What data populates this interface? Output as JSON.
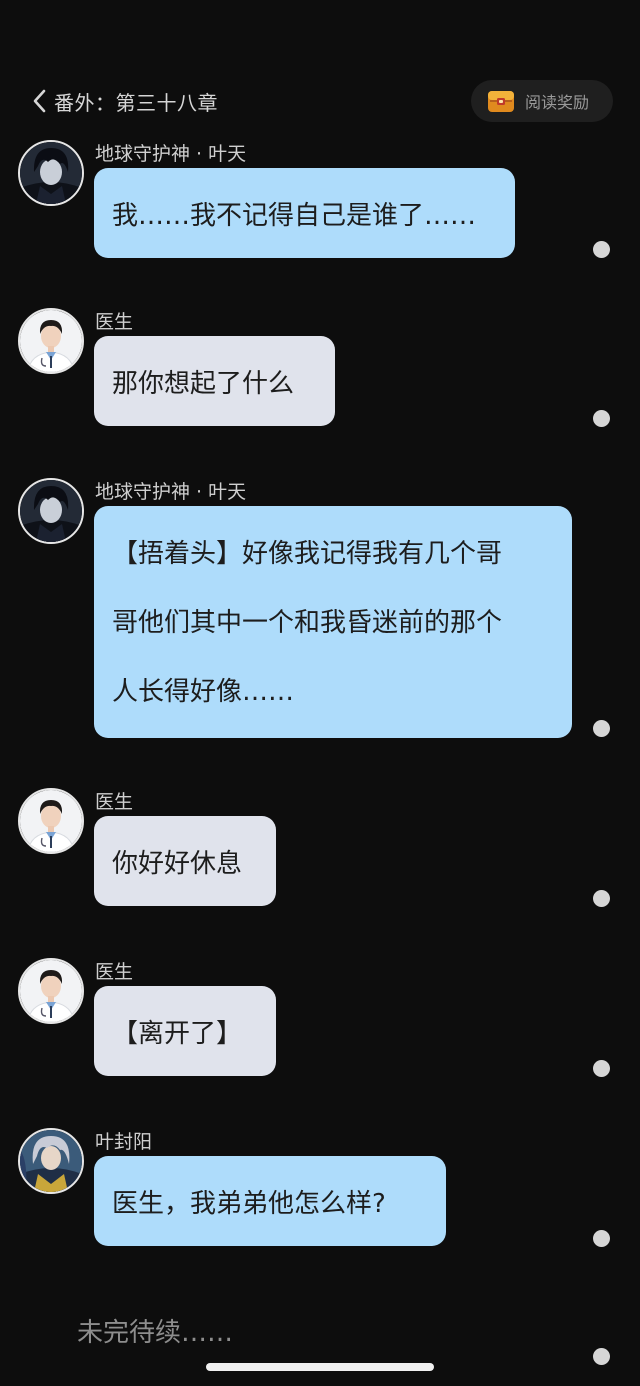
{
  "header": {
    "back_title": "番外：第三十八章",
    "reward_label": "阅读奖励"
  },
  "messages": [
    {
      "sender": "地球守护神 · 叶天",
      "text": "我……我不记得自己是谁了……"
    },
    {
      "sender": "医生",
      "text": "那你想起了什么"
    },
    {
      "sender": "地球守护神 · 叶天",
      "lines": [
        "【捂着头】好像我记得我有几个哥",
        "哥他们其中一个和我昏迷前的那个",
        "人长得好像……"
      ]
    },
    {
      "sender": "医生",
      "text": "你好好休息"
    },
    {
      "sender": "医生",
      "text": "【离开了】"
    },
    {
      "sender": "叶封阳",
      "text": "医生，我弟弟他怎么样?"
    }
  ],
  "footer": {
    "text": "未完待续……"
  },
  "colors": {
    "background": "#0d0d0d",
    "bubble_blue": "#aedcfb",
    "bubble_gray": "#e0e3ec"
  }
}
